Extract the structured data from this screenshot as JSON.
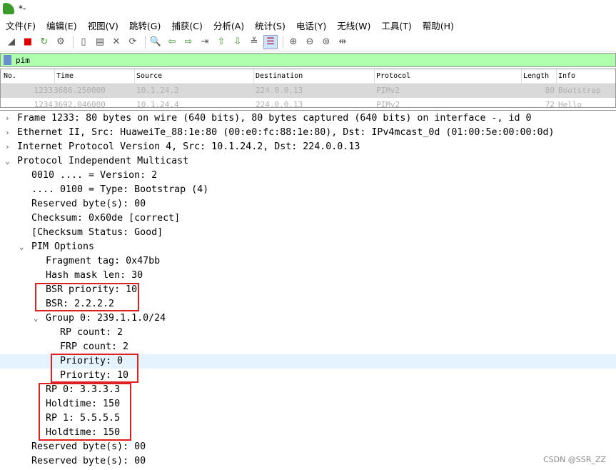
{
  "window": {
    "title": "*-"
  },
  "menu": [
    "文件(F)",
    "编辑(E)",
    "视图(V)",
    "跳转(G)",
    "捕获(C)",
    "分析(A)",
    "统计(S)",
    "电话(Y)",
    "无线(W)",
    "工具(T)",
    "帮助(H)"
  ],
  "toolbar": [
    "shark-fin-icon",
    "stop-icon",
    "restart-icon",
    "options-icon",
    "|",
    "open-icon",
    "save-icon",
    "close-icon",
    "reload-icon",
    "|",
    "find-icon",
    "back-icon",
    "forward-icon",
    "goto-icon",
    "first-icon",
    "last-icon",
    "autoscroll-icon",
    "colorize-icon",
    "|",
    "zoom-in-icon",
    "zoom-out-icon",
    "zoom-reset-icon",
    "resize-columns-icon"
  ],
  "filter": {
    "value": "pim"
  },
  "packet_list": {
    "columns": [
      "No.",
      "Time",
      "Source",
      "Destination",
      "Protocol",
      "Length",
      "Info"
    ],
    "rows": [
      [
        "1233",
        "3686.250000",
        "10.1.24.2",
        "224.0.0.13",
        "PIMv2",
        "80",
        "Bootstrap"
      ],
      [
        "1234",
        "3692.046000",
        "10.1.24.4",
        "224.0.0.13",
        "PIMv2",
        "72",
        "Hello"
      ]
    ]
  },
  "details": [
    {
      "text": "Frame 1233: 80 bytes on wire (640 bits), 80 bytes captured (640 bits) on interface -, id 0",
      "level": 0,
      "arrow": "right"
    },
    {
      "text": "Ethernet II, Src: HuaweiTe_88:1e:80 (00:e0:fc:88:1e:80), Dst: IPv4mcast_0d (01:00:5e:00:00:0d)",
      "level": 0,
      "arrow": "right"
    },
    {
      "text": "Internet Protocol Version 4, Src: 10.1.24.2, Dst: 224.0.0.13",
      "level": 0,
      "arrow": "right"
    },
    {
      "text": "Protocol Independent Multicast",
      "level": 0,
      "arrow": "down"
    },
    {
      "text": "0010 .... = Version: 2",
      "level": 1
    },
    {
      "text": ".... 0100 = Type: Bootstrap (4)",
      "level": 1
    },
    {
      "text": "Reserved byte(s): 00",
      "level": 1
    },
    {
      "text": "Checksum: 0x60de [correct]",
      "level": 1
    },
    {
      "text": "[Checksum Status: Good]",
      "level": 1
    },
    {
      "text": "PIM Options",
      "level": 1,
      "arrow": "down"
    },
    {
      "text": "Fragment tag: 0x47bb",
      "level": 2
    },
    {
      "text": "Hash mask len: 30",
      "level": 2
    },
    {
      "text": "BSR priority: 10",
      "level": 2
    },
    {
      "text": "BSR: 2.2.2.2",
      "level": 2
    },
    {
      "text": "Group 0: 239.1.1.0/24",
      "level": 2,
      "arrow": "down"
    },
    {
      "text": "RP count: 2",
      "level": 3
    },
    {
      "text": "FRP count: 2",
      "level": 3
    },
    {
      "text": "Priority: 0",
      "level": 3,
      "highlight": true
    },
    {
      "text": "Priority: 10",
      "level": 3
    },
    {
      "text": "RP 0: 3.3.3.3",
      "level": 2
    },
    {
      "text": "Holdtime: 150",
      "level": 2
    },
    {
      "text": "RP 1: 5.5.5.5",
      "level": 2
    },
    {
      "text": "Holdtime: 150",
      "level": 2
    },
    {
      "text": "Reserved byte(s): 00",
      "level": 1
    },
    {
      "text": "Reserved byte(s): 00",
      "level": 1
    }
  ],
  "watermark": "CSDN @SSR_ZZ",
  "colors": {
    "filter_ok": "#afffaf",
    "selected_row": "#d9d9d9",
    "highlight": "#e5f3ff",
    "annotation_box": "#e02020"
  }
}
